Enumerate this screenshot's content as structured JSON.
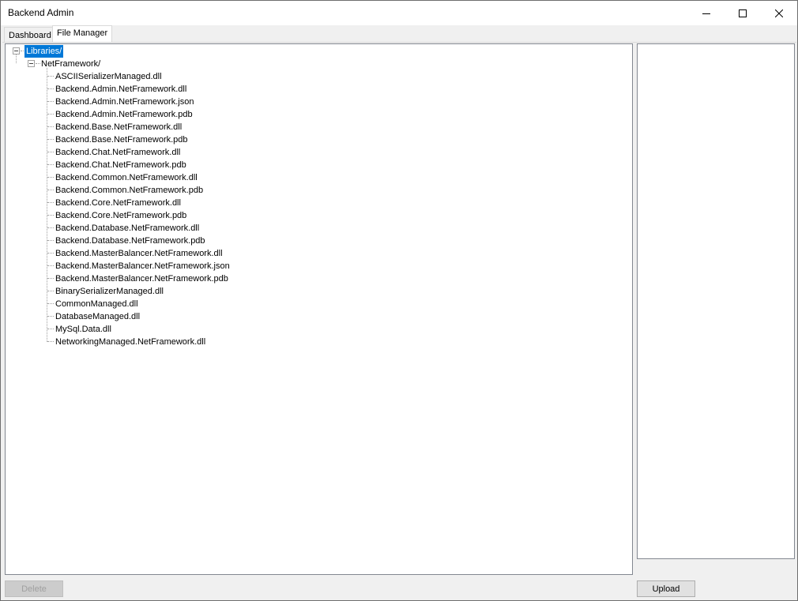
{
  "window": {
    "title": "Backend Admin"
  },
  "tabs": [
    {
      "label": "Dashboard"
    },
    {
      "label": "File Manager"
    }
  ],
  "tree": {
    "root": "Libraries/",
    "folder": "NetFramework/",
    "files": [
      "ASCIISerializerManaged.dll",
      "Backend.Admin.NetFramework.dll",
      "Backend.Admin.NetFramework.json",
      "Backend.Admin.NetFramework.pdb",
      "Backend.Base.NetFramework.dll",
      "Backend.Base.NetFramework.pdb",
      "Backend.Chat.NetFramework.dll",
      "Backend.Chat.NetFramework.pdb",
      "Backend.Common.NetFramework.dll",
      "Backend.Common.NetFramework.pdb",
      "Backend.Core.NetFramework.dll",
      "Backend.Core.NetFramework.pdb",
      "Backend.Database.NetFramework.dll",
      "Backend.Database.NetFramework.pdb",
      "Backend.MasterBalancer.NetFramework.dll",
      "Backend.MasterBalancer.NetFramework.json",
      "Backend.MasterBalancer.NetFramework.pdb",
      "BinarySerializerManaged.dll",
      "CommonManaged.dll",
      "DatabaseManaged.dll",
      "MySql.Data.dll",
      "NetworkingManaged.NetFramework.dll"
    ]
  },
  "buttons": {
    "delete": "Delete",
    "upload": "Upload"
  },
  "colors": {
    "selection": "#0078d7"
  }
}
